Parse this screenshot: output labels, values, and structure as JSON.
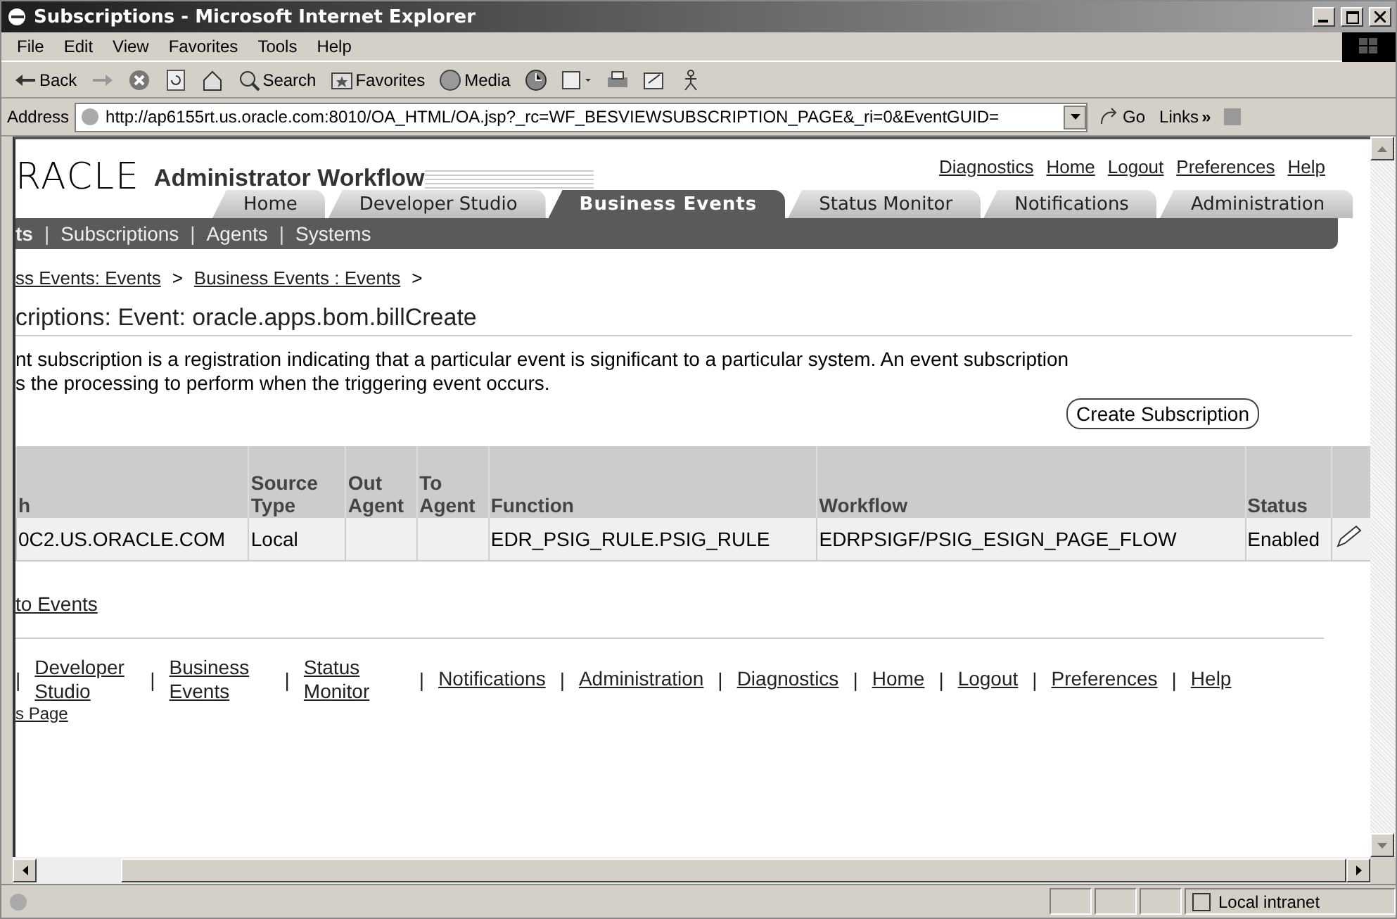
{
  "window": {
    "title": "Subscriptions - Microsoft Internet Explorer"
  },
  "menu": [
    "File",
    "Edit",
    "View",
    "Favorites",
    "Tools",
    "Help"
  ],
  "toolbar": [
    {
      "kind": "back",
      "label": "Back"
    },
    {
      "kind": "forward"
    },
    {
      "kind": "stop"
    },
    {
      "kind": "refresh"
    },
    {
      "kind": "home"
    },
    {
      "kind": "search",
      "label": "Search"
    },
    {
      "kind": "favorites",
      "label": "Favorites"
    },
    {
      "kind": "media",
      "label": "Media"
    },
    {
      "kind": "history"
    },
    {
      "kind": "mail"
    },
    {
      "kind": "print"
    },
    {
      "kind": "edit"
    },
    {
      "kind": "messenger"
    }
  ],
  "address": {
    "label": "Address",
    "url": "http://ap6155rt.us.oracle.com:8010/OA_HTML/OA.jsp?_rc=WF_BESVIEWSUBSCRIPTION_PAGE&_ri=0&EventGUID=",
    "go": "Go",
    "links": "Links",
    "chevron": "»"
  },
  "header": {
    "logo": "RACLE",
    "app_title": "Administrator Workflow",
    "global_links": [
      "Diagnostics",
      "Home",
      "Logout",
      "Preferences",
      "Help"
    ]
  },
  "tabs": [
    {
      "label": "Home",
      "selected": false
    },
    {
      "label": "Developer Studio",
      "selected": false
    },
    {
      "label": "Business Events",
      "selected": true
    },
    {
      "label": "Status Monitor",
      "selected": false
    },
    {
      "label": "Notifications",
      "selected": false
    },
    {
      "label": "Administration",
      "selected": false
    }
  ],
  "subtabs": {
    "separator": "|",
    "items": [
      {
        "label": "ts",
        "selected": true
      },
      {
        "label": "Subscriptions",
        "selected": false
      },
      {
        "label": "Agents",
        "selected": false
      },
      {
        "label": "Systems",
        "selected": false
      }
    ]
  },
  "breadcrumbs": {
    "separator": ">",
    "items": [
      "ss Events: Events",
      "Business Events : Events"
    ]
  },
  "heading": "criptions: Event: oracle.apps.bom.billCreate",
  "description": [
    "nt subscription is a registration indicating that a particular event is significant to a particular system. An event subscription",
    "s the processing to perform when the triggering event occurs."
  ],
  "create_button": "Create Subscription",
  "table": {
    "columns": [
      "h",
      "Source Type",
      "Out Agent",
      "To Agent",
      "Function",
      "Workflow",
      "Status"
    ],
    "rows": [
      {
        "cells": [
          "0C2.US.ORACLE.COM",
          "Local",
          "",
          "",
          "EDR_PSIG_RULE.PSIG_RULE",
          "EDRPSIGF/PSIG_ESIGN_PAGE_FLOW",
          "Enabled"
        ]
      }
    ]
  },
  "return_link": "to Events",
  "footer": {
    "separator": "|",
    "links": [
      "Developer Studio",
      "Business Events",
      "Status Monitor",
      "Notifications",
      "Administration",
      "Diagnostics",
      "Home",
      "Logout",
      "Preferences",
      "Help"
    ],
    "note": "s Page"
  },
  "status_bar": {
    "zone": "Local intranet"
  }
}
